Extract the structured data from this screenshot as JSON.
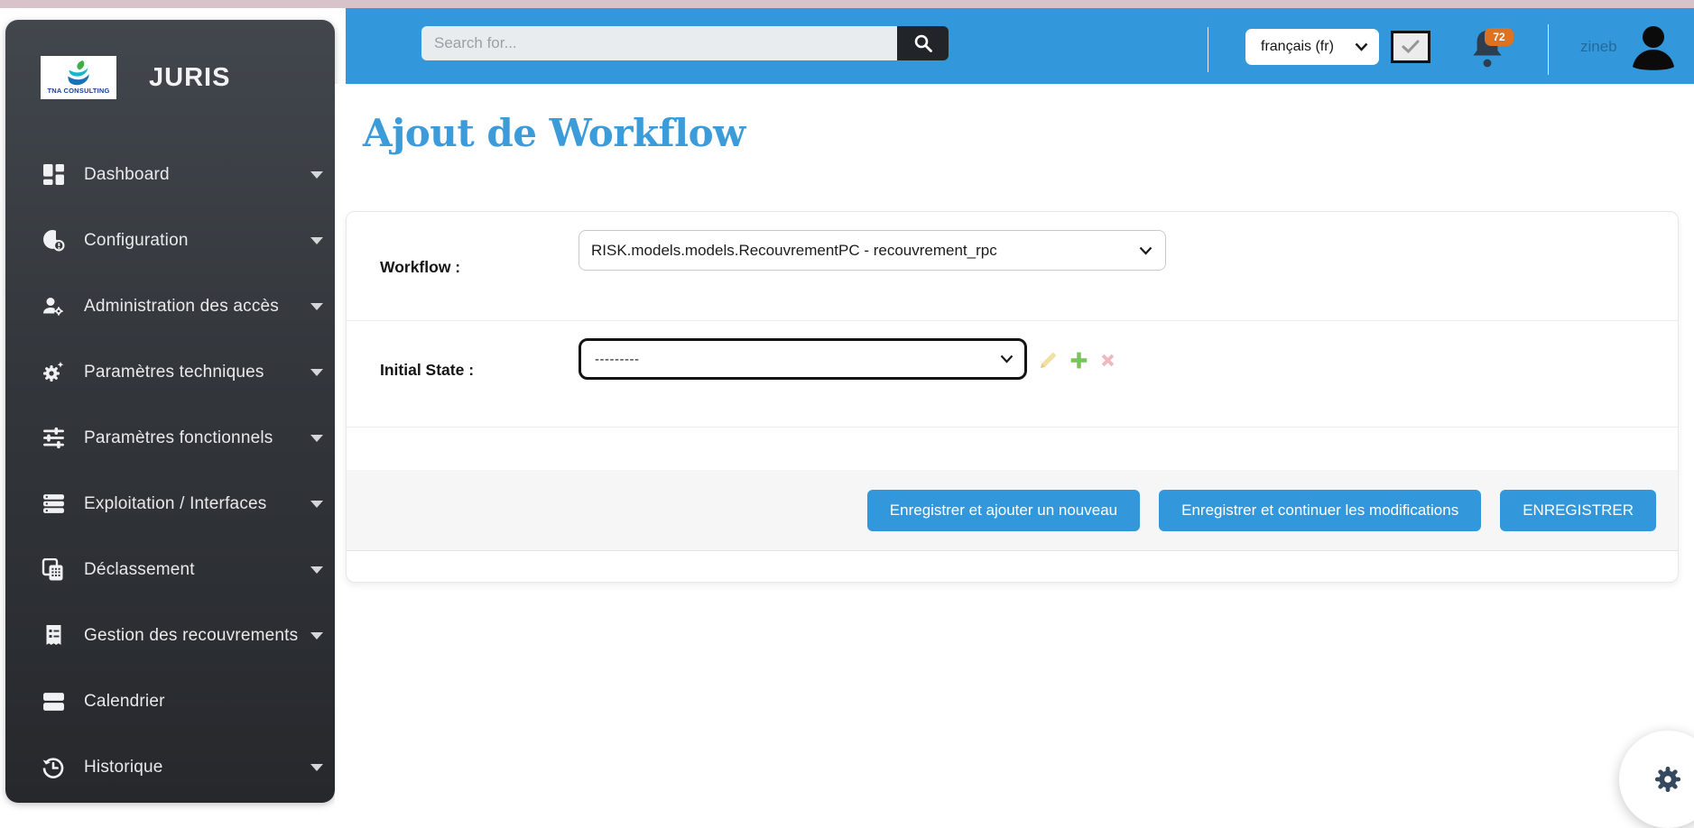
{
  "app": {
    "brand": "JURIS",
    "logo_text": "TNA CONSULTING"
  },
  "topbar": {
    "search_placeholder": "Search for...",
    "search_icon": "magnifier-icon",
    "language_selected": "français (fr)",
    "check_button_icon": "checkmark-icon",
    "notifications_count": "72",
    "username": "zineb"
  },
  "sidebar": {
    "items": [
      {
        "label": "Dashboard",
        "icon": "dashboard-grid-icon",
        "has_submenu": true
      },
      {
        "label": "Configuration",
        "icon": "config-donut-icon",
        "has_submenu": true
      },
      {
        "label": "Administration des accès",
        "icon": "user-gear-icon",
        "has_submenu": true
      },
      {
        "label": "Paramètres techniques",
        "icon": "gear-sparkle-icon",
        "has_submenu": true
      },
      {
        "label": "Paramètres fonctionnels",
        "icon": "sliders-icon",
        "has_submenu": true
      },
      {
        "label": "Exploitation / Interfaces",
        "icon": "server-stack-icon",
        "has_submenu": true
      },
      {
        "label": "Déclassement",
        "icon": "copy-calculator-icon",
        "has_submenu": true
      },
      {
        "label": "Gestion des recouvrements",
        "icon": "receipt-icon",
        "has_submenu": true
      },
      {
        "label": "Calendrier",
        "icon": "calendar-bars-icon",
        "has_submenu": false
      },
      {
        "label": "Historique",
        "icon": "history-clock-icon",
        "has_submenu": true
      }
    ]
  },
  "main": {
    "title": "Ajout de Workflow",
    "form": {
      "workflow_label": "Workflow :",
      "workflow_value": "RISK.models.models.RecouvrementPC - recouvrement_rpc",
      "initial_state_label": "Initial State :",
      "initial_state_value": "---------",
      "related_actions": [
        "edit-pencil-icon",
        "add-plus-icon",
        "delete-x-icon"
      ]
    },
    "buttons": {
      "save_add_label": "Enregistrer et ajouter un nouveau",
      "save_continue_label": "Enregistrer et continuer les modifications",
      "save_label": "ENREGISTRER"
    }
  },
  "colors": {
    "accent_blue": "#3298db",
    "title_blue": "#3c9bd9",
    "sidebar_dark": "#33373c",
    "badge_orange": "#dd7220",
    "search_button_dark": "#212529",
    "icon_pencil": "#f1dfa3",
    "icon_plus": "#77c35c",
    "icon_x": "#f0b9c2",
    "bell_navy": "#2c3e50",
    "top_strip_pink": "#d9c3cb"
  }
}
